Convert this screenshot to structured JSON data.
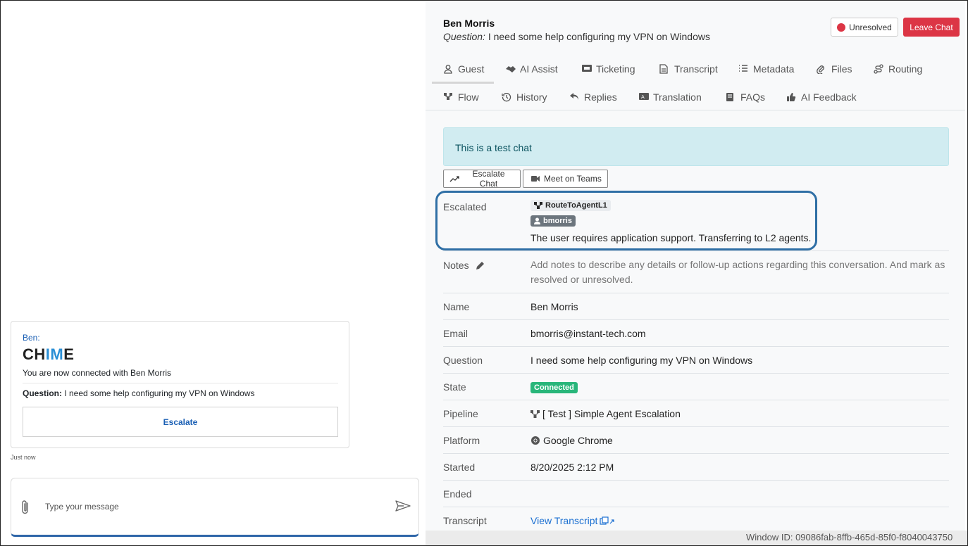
{
  "left": {
    "message": {
      "sender": "Ben:",
      "logo_text": {
        "a": "CH",
        "b": "IM",
        "c": "E"
      },
      "connected_text": "You are now connected with Ben Morris",
      "question_label": "Question:",
      "question_text": " I need some help configuring my VPN on Windows",
      "escalate_label": "Escalate",
      "time": "Just now"
    },
    "composer": {
      "placeholder": "Type your message",
      "attach_icon": "paperclip-icon",
      "send_icon": "send-icon"
    }
  },
  "header": {
    "name": "Ben Morris",
    "question_label": "Question:",
    "question_text": " I need some help configuring my VPN on Windows",
    "unresolved_label": "Unresolved",
    "leave_label": "Leave Chat"
  },
  "tabs": {
    "guest": "Guest",
    "ai_assist": "AI Assist",
    "ticketing": "Ticketing",
    "transcript": "Transcript",
    "metadata": "Metadata",
    "files": "Files",
    "routing": "Routing",
    "flow": "Flow",
    "history": "History",
    "replies": "Replies",
    "translation": "Translation",
    "faqs": "FAQs",
    "ai_feedback": "AI Feedback",
    "active": "Guest"
  },
  "content": {
    "alert": "This is a test chat",
    "escalate_chat_label": "Escalate Chat",
    "meet_teams_label": "Meet on Teams",
    "escalated": {
      "label": "Escalated",
      "route": "RouteToAgentL1",
      "user": "bmorris",
      "reason": "The user requires application support. Transferring to L2 agents."
    },
    "notes": {
      "label": "Notes",
      "text": "Add notes to describe any details or follow-up actions regarding this conversation. And mark as resolved or unresolved."
    },
    "name": {
      "label": "Name",
      "value": "Ben Morris"
    },
    "email": {
      "label": "Email",
      "value": "bmorris@instant-tech.com"
    },
    "question": {
      "label": "Question",
      "value": "I need some help configuring my VPN on Windows"
    },
    "state": {
      "label": "State",
      "value": "Connected"
    },
    "pipeline": {
      "label": "Pipeline",
      "value": "[ Test ] Simple Agent Escalation"
    },
    "platform": {
      "label": "Platform",
      "value": "Google Chrome"
    },
    "started": {
      "label": "Started",
      "value": "8/20/2025 2:12 PM"
    },
    "ended": {
      "label": "Ended",
      "value": ""
    },
    "transcript": {
      "label": "Transcript",
      "link": "View Transcript"
    }
  },
  "footer": {
    "window_id": "Window ID: 09086fab-8ffb-465d-85f0-f8040043750"
  },
  "colors": {
    "danger": "#dc3545",
    "success": "#28b67a",
    "link": "#1a6fd1",
    "highlight_border": "#2f6fa5",
    "alert_bg": "#d1ecf1"
  }
}
